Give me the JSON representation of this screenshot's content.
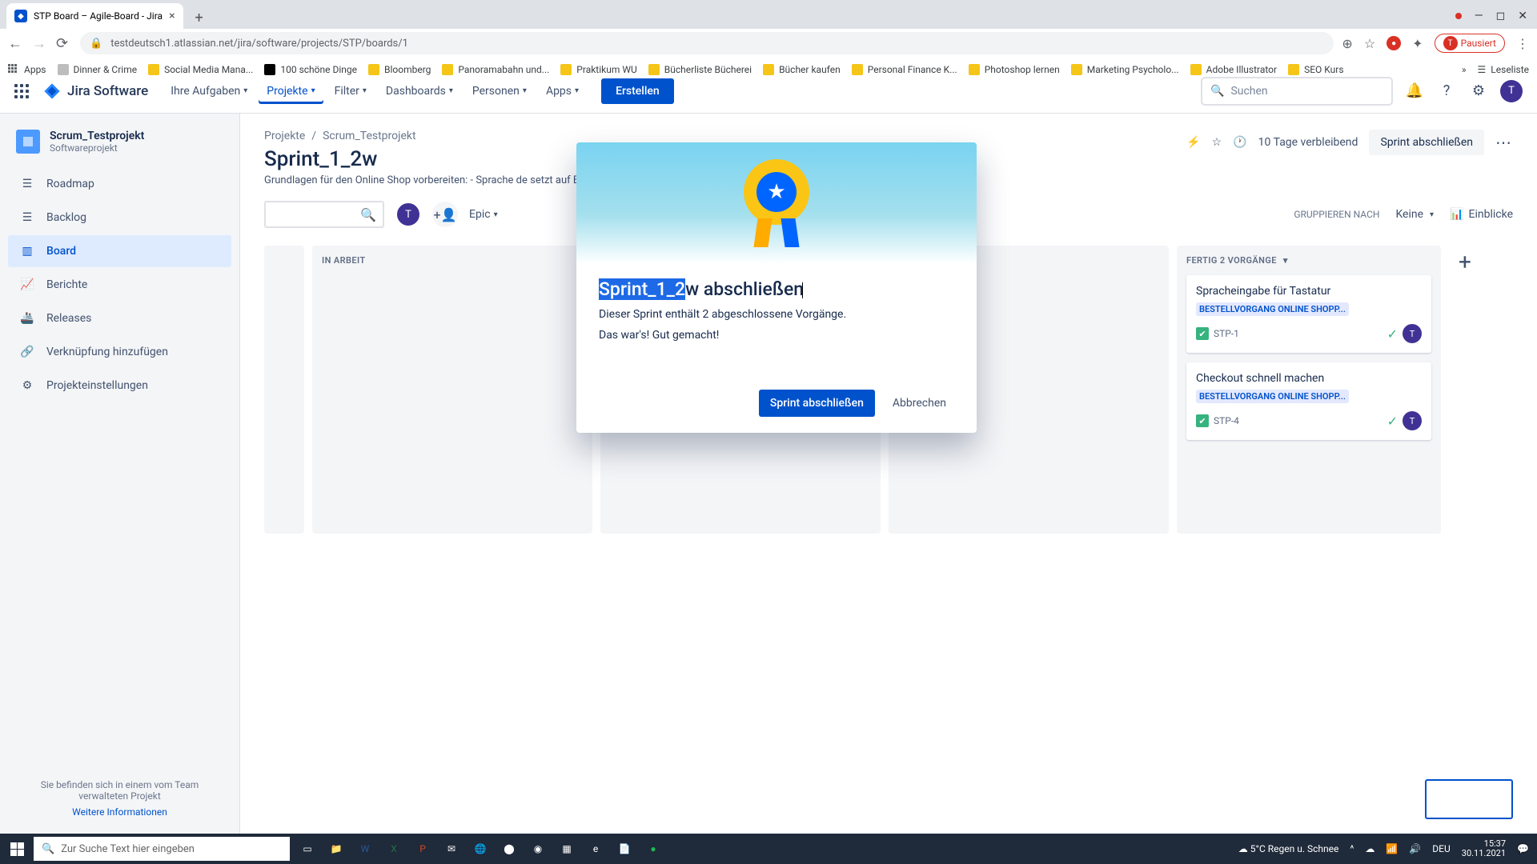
{
  "browser": {
    "tab_title": "STP Board – Agile-Board - Jira",
    "url": "testdeutsch1.atlassian.net/jira/software/projects/STP/boards/1",
    "paused": "Pausiert",
    "bookmarks": [
      "Apps",
      "Dinner & Crime",
      "Social Media Mana...",
      "100 schöne Dinge",
      "Bloomberg",
      "Panoramabahn und...",
      "Praktikum WU",
      "Bücherliste Bücherei",
      "Bücher kaufen",
      "Personal Finance K...",
      "Photoshop lernen",
      "Marketing Psycholo...",
      "Adobe Illustrator",
      "SEO Kurs"
    ],
    "readlist": "Leseliste"
  },
  "nav": {
    "product": "Jira Software",
    "items": [
      "Ihre Aufgaben",
      "Projekte",
      "Filter",
      "Dashboards",
      "Personen",
      "Apps"
    ],
    "active_index": 1,
    "create": "Erstellen",
    "search_ph": "Suchen"
  },
  "sidebar": {
    "project_name": "Scrum_Testprojekt",
    "project_type": "Softwareprojekt",
    "items": [
      "Roadmap",
      "Backlog",
      "Board",
      "Berichte",
      "Releases",
      "Verknüpfung hinzufügen",
      "Projekteinstellungen"
    ],
    "active_index": 2,
    "footer1": "Sie befinden sich in einem vom Team verwalteten Projekt",
    "footer2": "Weitere Informationen"
  },
  "page": {
    "crumb1": "Projekte",
    "crumb2": "Scrum_Testprojekt",
    "title": "Sprint_1_2w",
    "desc": "Grundlagen für den Online Shop vorbereiten: - Sprache                                                                                                de setzt auf Bestellgeschwindigkeit)",
    "days_remaining": "10 Tage verbleibend",
    "close_sprint": "Sprint abschließen",
    "epic": "Epic",
    "group_by_label": "GRUPPIEREN NACH",
    "group_by_value": "Keine",
    "insights": "Einblicke"
  },
  "columns": {
    "in_progress": "IN ARBEIT",
    "done_header": "FERTIG 2 VORGÄNGE"
  },
  "cards": [
    {
      "title": "Spracheingabe für Tastatur",
      "epic": "BESTELLVORGANG ONLINE SHOPP...",
      "key": "STP-1"
    },
    {
      "title": "Checkout schnell machen",
      "epic": "BESTELLVORGANG ONLINE SHOPP...",
      "key": "STP-4"
    }
  ],
  "modal": {
    "title_hl": "Sprint_1_2",
    "title_rest": "w abschließen",
    "line1": "Dieser Sprint enthält  2 abgeschlossene Vorgänge.",
    "line2": "Das war's! Gut gemacht!",
    "primary": "Sprint abschließen",
    "secondary": "Abbrechen"
  },
  "taskbar": {
    "search_ph": "Zur Suche Text hier eingeben",
    "weather": "5°C  Regen u. Schnee",
    "lang": "DEU",
    "time": "15:37",
    "date": "30.11.2021"
  },
  "avatar_letter": "T"
}
